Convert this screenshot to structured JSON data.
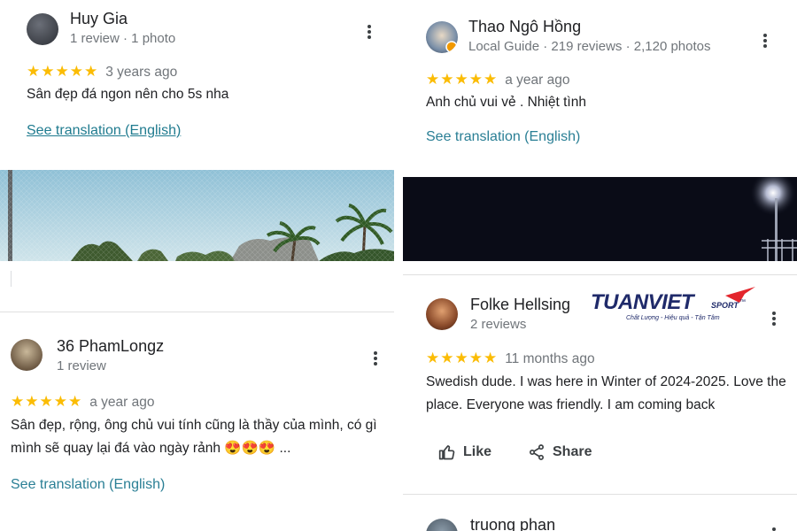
{
  "reviews": [
    {
      "name": "Huy Gia",
      "meta": "1 review · 1 photo",
      "time": "3 years ago",
      "stars": "★★★★★",
      "text": "Sân đẹp đá ngon nên cho 5s nha",
      "translation": "See translation (English)"
    },
    {
      "name": "36 PhamLongz",
      "meta": "1 review",
      "time": "a year ago",
      "stars": "★★★★★",
      "text": "Sân đẹp, rộng, ông chủ vui tính cũng là thầy của mình, có gì mình sẽ quay lại đá vào ngày rảnh 😍😍😍 ...",
      "translation": "See translation (English)"
    },
    {
      "name": "Thao Ngô Hồng",
      "meta": "Local Guide · 219 reviews · 2,120 photos",
      "time": "a year ago",
      "stars": "★★★★★",
      "text": "Anh chủ vui vẻ . Nhiệt tình",
      "translation": "See translation (English)"
    },
    {
      "name": "Folke Hellsing",
      "meta": "2 reviews",
      "time": "11 months ago",
      "stars": "★★★★★",
      "text": "Swedish dude. I was here in Winter of 2024-2025. Love the place. Everyone was friendly. I am coming back",
      "like_label": "Like",
      "share_label": "Share"
    },
    {
      "name": "truong phan"
    }
  ],
  "watermark": {
    "brand": "TUANVIET",
    "sub": "SPORT",
    "tm": "™",
    "tagline": "Chất Lượng - Hiệu quả - Tận Tâm"
  },
  "colors": {
    "star": "#fbbc04",
    "link": "#1a73e8"
  }
}
